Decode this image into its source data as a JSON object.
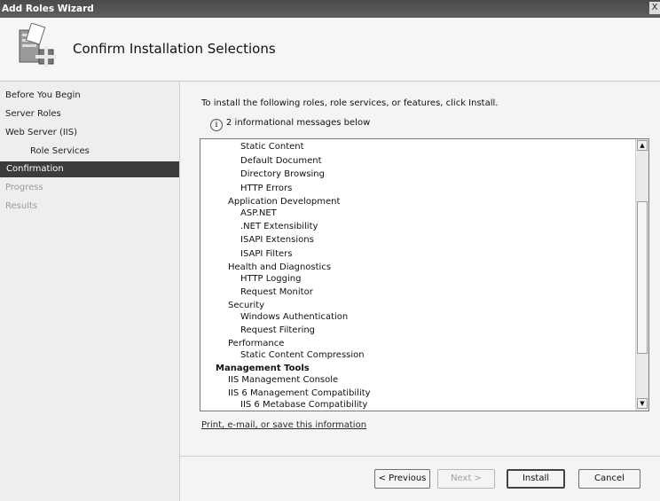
{
  "window": {
    "title": "Add Roles Wizard",
    "close_glyph": "X"
  },
  "header": {
    "title": "Confirm Installation Selections",
    "icon": "server-roles-icon"
  },
  "sidebar": {
    "items": [
      {
        "label": "Before You Begin"
      },
      {
        "label": "Server Roles"
      },
      {
        "label": "Web Server (IIS)"
      },
      {
        "label": "Role Services"
      },
      {
        "label": "Confirmation"
      },
      {
        "label": "Progress"
      },
      {
        "label": "Results"
      }
    ]
  },
  "content": {
    "intro": "To install the following roles, role services, or features, click Install.",
    "info_icon": "i",
    "info_text": "2 informational messages below",
    "list": [
      "Static Content",
      "Default Document",
      "Directory Browsing",
      "HTTP Errors",
      "Application Development",
      "ASP.NET",
      ".NET Extensibility",
      "ISAPI Extensions",
      "ISAPI Filters",
      "Health and Diagnostics",
      "HTTP Logging",
      "Request Monitor",
      "Security",
      "Windows Authentication",
      "Request Filtering",
      "Performance",
      "Static Content Compression",
      "Management Tools",
      "IIS Management Console",
      "IIS 6 Management Compatibility",
      "IIS 6 Metabase Compatibility"
    ],
    "scroll_up_glyph": "▲",
    "scroll_down_glyph": "▼",
    "print_link": "Print, e-mail, or save this information"
  },
  "buttons": {
    "previous": "< Previous",
    "next": "Next >",
    "install": "Install",
    "cancel": "Cancel"
  }
}
